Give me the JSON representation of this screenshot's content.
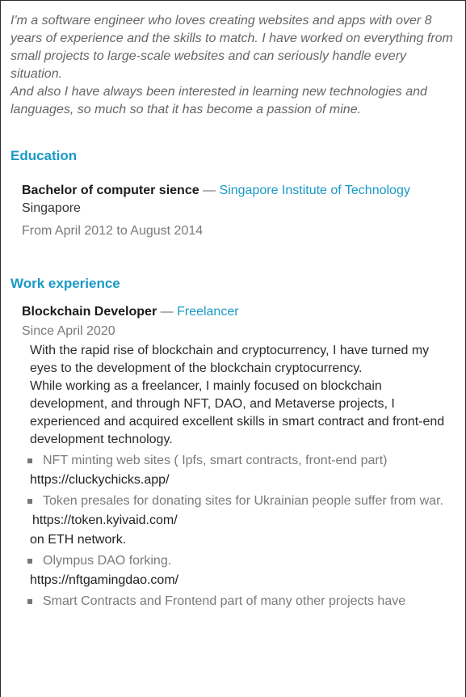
{
  "intro": {
    "p1": "I'm a software engineer who loves creating websites and apps with over 8 years of experience and the skills to match. I have worked on everything from small projects to large-scale websites and can seriously handle every situation.",
    "p2": "And also I have always been interested in learning new technologies and languages, so much so that it has become a passion of mine."
  },
  "education": {
    "title": "Education",
    "degree": "Bachelor of computer sience",
    "separator": "—",
    "school": "Singapore Institute of Technology",
    "location": "Singapore",
    "dates": "From April 2012 to August 2014"
  },
  "work": {
    "title": "Work experience",
    "role": "Blockchain Developer",
    "separator": "—",
    "org": "Freelancer",
    "dates": "Since April 2020",
    "desc1": "With the rapid rise of blockchain and cryptocurrency, I have turned my eyes to the development of the blockchain cryptocurrency.",
    "desc2": "While working as a freelancer, I mainly focused on blockchain development, and through NFT, DAO, and Metaverse projects, I experienced and acquired excellent skills in smart contract and front-end development technology.",
    "projects": [
      {
        "text": "NFT minting web sites ( Ipfs, smart contracts, front-end part)",
        "link": "https://cluckychicks.app/",
        "note": ""
      },
      {
        "text": "Token presales for donating sites for Ukrainian people suffer from war.",
        "link": "https://token.kyivaid.com/",
        "note": "on ETH network."
      },
      {
        "text": "Olympus DAO forking.",
        "link": "https://nftgamingdao.com/",
        "note": ""
      },
      {
        "text": "Smart Contracts and Frontend part of many other projects have"
      }
    ]
  },
  "colors": {
    "accent": "#1a99c6",
    "muted": "#7a7a7a"
  }
}
